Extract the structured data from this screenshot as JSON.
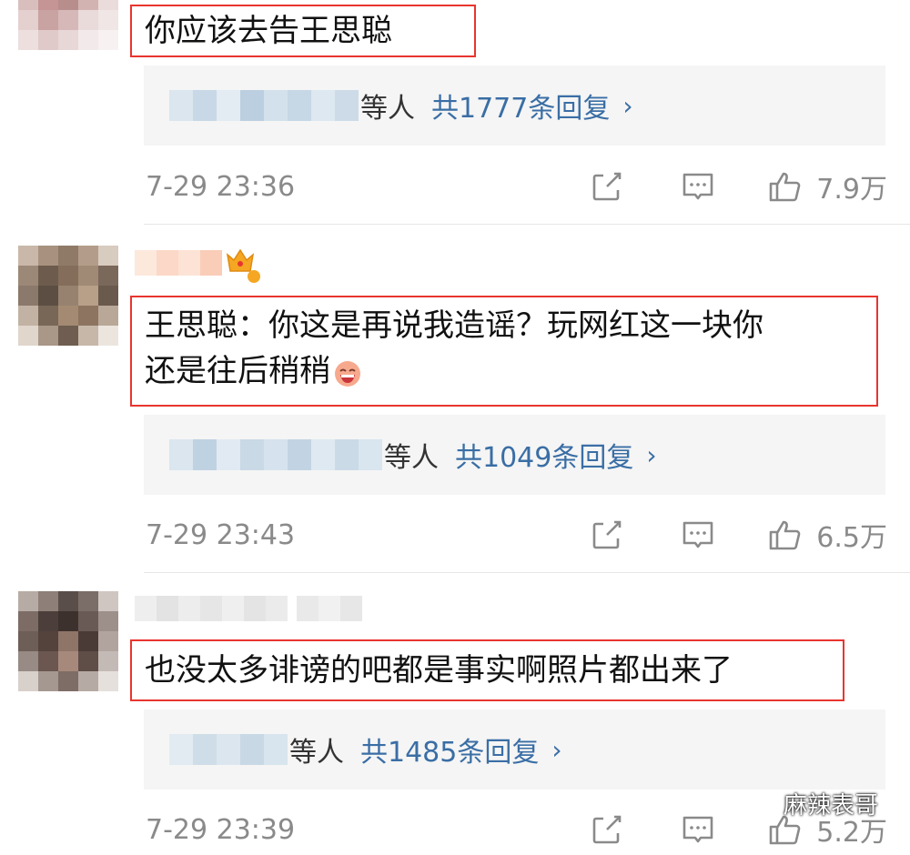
{
  "comments": [
    {
      "text": "你应该去告王思聪",
      "reply_suffix": "等人",
      "reply_count": "共1777条回复",
      "time": "7-29 23:36",
      "likes": "7.9万"
    },
    {
      "text_line1": "王思聪：你这是再说我造谣？玩网红这一块你",
      "text_line2": "还是往后稍稍",
      "reply_suffix": "等人",
      "reply_count": "共1049条回复",
      "time": "7-29 23:43",
      "likes": "6.5万"
    },
    {
      "text": "也没太多诽谤的吧都是事实啊照片都出来了",
      "reply_suffix": "等人",
      "reply_count": "共1485条回复",
      "time": "7-29 23:39",
      "likes": "5.2万"
    }
  ],
  "icons": {
    "arrow": "›",
    "share": "share-icon",
    "comment": "comment-icon",
    "like": "thumbs-up-icon",
    "emoji": "laughing-emoji-icon",
    "crown": "crown-badge-icon"
  },
  "colors": {
    "highlight_border": "#e8352f",
    "link_blue": "#3a6ea5",
    "meta_gray": "#8a8a8a",
    "reply_bg": "#f5f5f5"
  },
  "watermark": {
    "text": "麻辣表哥"
  }
}
